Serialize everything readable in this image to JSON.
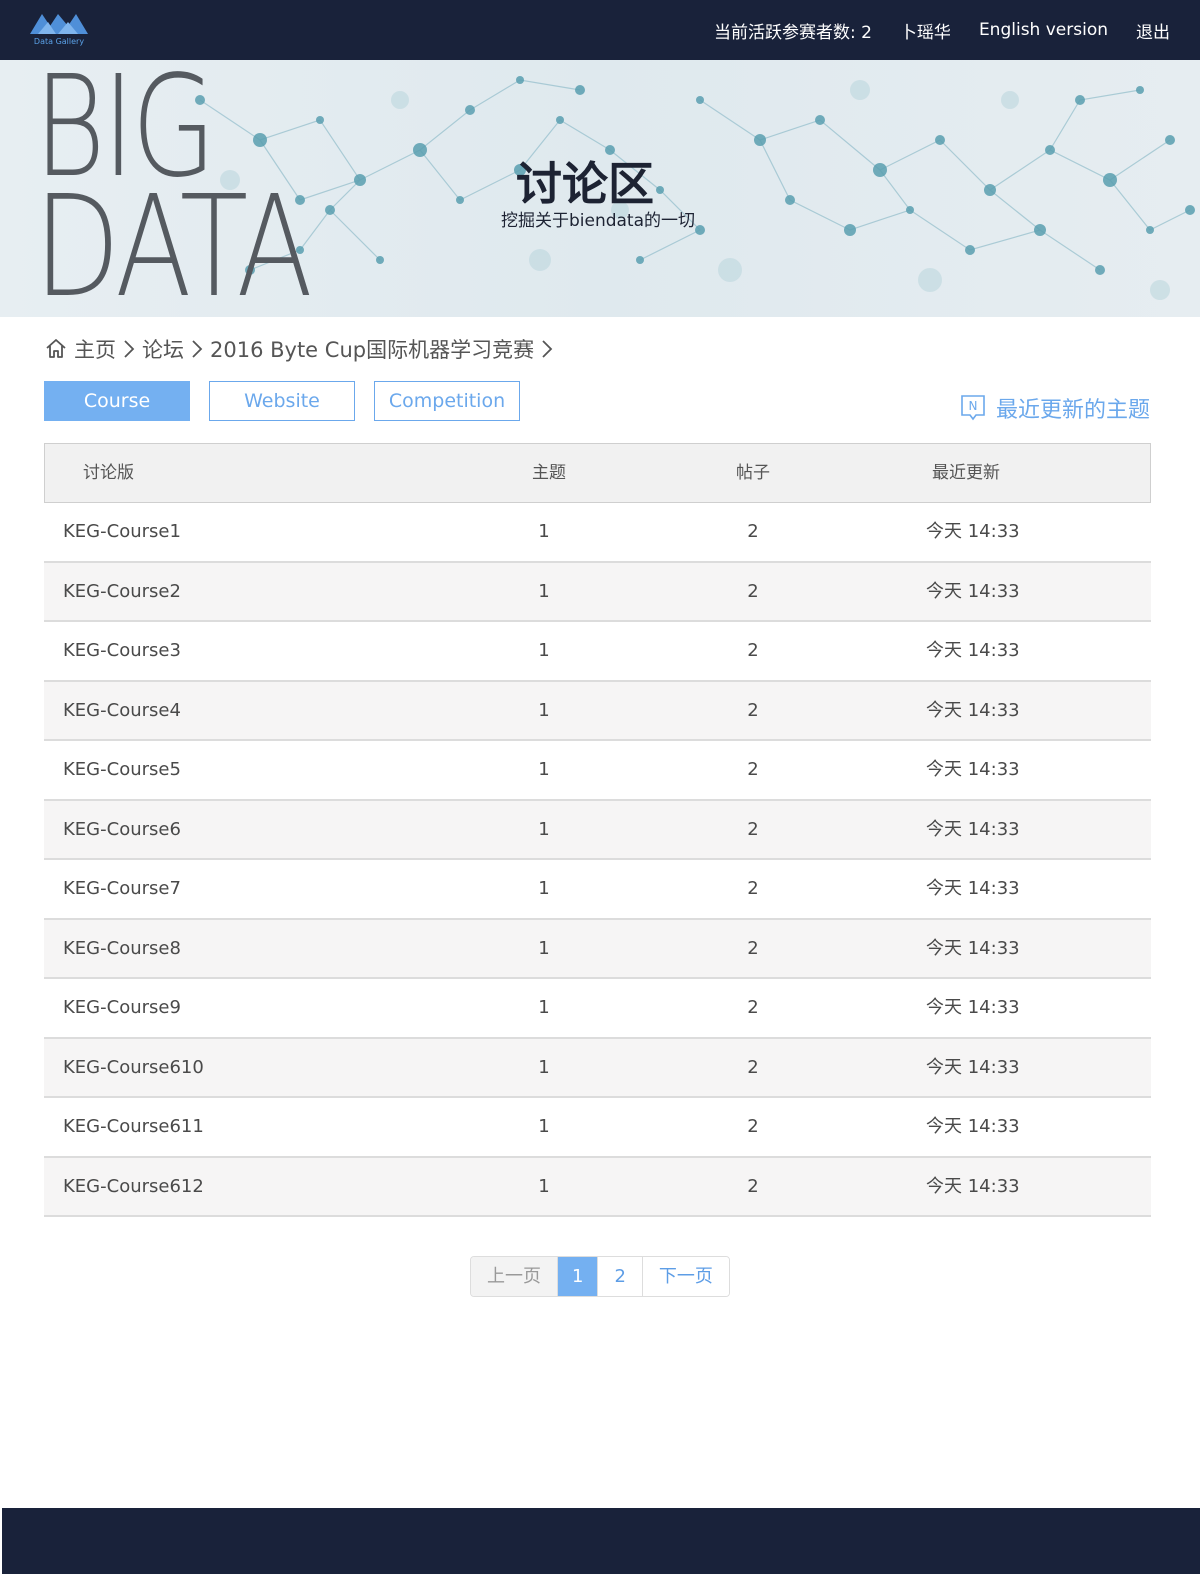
{
  "header": {
    "logo_text": "Data Gallery",
    "active_count_label": "当前活跃参赛者数: 2",
    "user_name": "卜瑶华",
    "english_label": "English version",
    "logout_label": "退出"
  },
  "banner": {
    "big_line1": "BIG",
    "big_line2": "DATA",
    "title": "讨论区",
    "subtitle": "挖掘关于biendata的一切"
  },
  "breadcrumb": {
    "home": "主页",
    "forum": "论坛",
    "current": "2016 Byte Cup国际机器学习竞赛"
  },
  "tabs": [
    {
      "label": "Course",
      "active": true
    },
    {
      "label": "Website",
      "active": false
    },
    {
      "label": "Competition",
      "active": false
    }
  ],
  "recent_topics_label": "最近更新的主题",
  "table": {
    "headers": {
      "board": "讨论版",
      "topics": "主题",
      "posts": "帖子",
      "updated": "最近更新"
    },
    "rows": [
      {
        "name": "KEG-Course1",
        "topics": "1",
        "posts": "2",
        "updated": "今天 14:33"
      },
      {
        "name": "KEG-Course2",
        "topics": "1",
        "posts": "2",
        "updated": "今天 14:33"
      },
      {
        "name": "KEG-Course3",
        "topics": "1",
        "posts": "2",
        "updated": "今天 14:33"
      },
      {
        "name": "KEG-Course4",
        "topics": "1",
        "posts": "2",
        "updated": "今天 14:33"
      },
      {
        "name": "KEG-Course5",
        "topics": "1",
        "posts": "2",
        "updated": "今天 14:33"
      },
      {
        "name": "KEG-Course6",
        "topics": "1",
        "posts": "2",
        "updated": "今天 14:33"
      },
      {
        "name": "KEG-Course7",
        "topics": "1",
        "posts": "2",
        "updated": "今天 14:33"
      },
      {
        "name": "KEG-Course8",
        "topics": "1",
        "posts": "2",
        "updated": "今天 14:33"
      },
      {
        "name": "KEG-Course9",
        "topics": "1",
        "posts": "2",
        "updated": "今天 14:33"
      },
      {
        "name": "KEG-Course610",
        "topics": "1",
        "posts": "2",
        "updated": "今天 14:33"
      },
      {
        "name": "KEG-Course611",
        "topics": "1",
        "posts": "2",
        "updated": "今天 14:33"
      },
      {
        "name": "KEG-Course612",
        "topics": "1",
        "posts": "2",
        "updated": "今天 14:33"
      }
    ]
  },
  "pagination": {
    "prev_label": "上一页",
    "pages": [
      "1",
      "2"
    ],
    "current_page": "1",
    "next_label": "下一页"
  },
  "colors": {
    "nav_bg": "#19223a",
    "accent": "#74b0f1",
    "accent_text": "#6ba8ec"
  }
}
